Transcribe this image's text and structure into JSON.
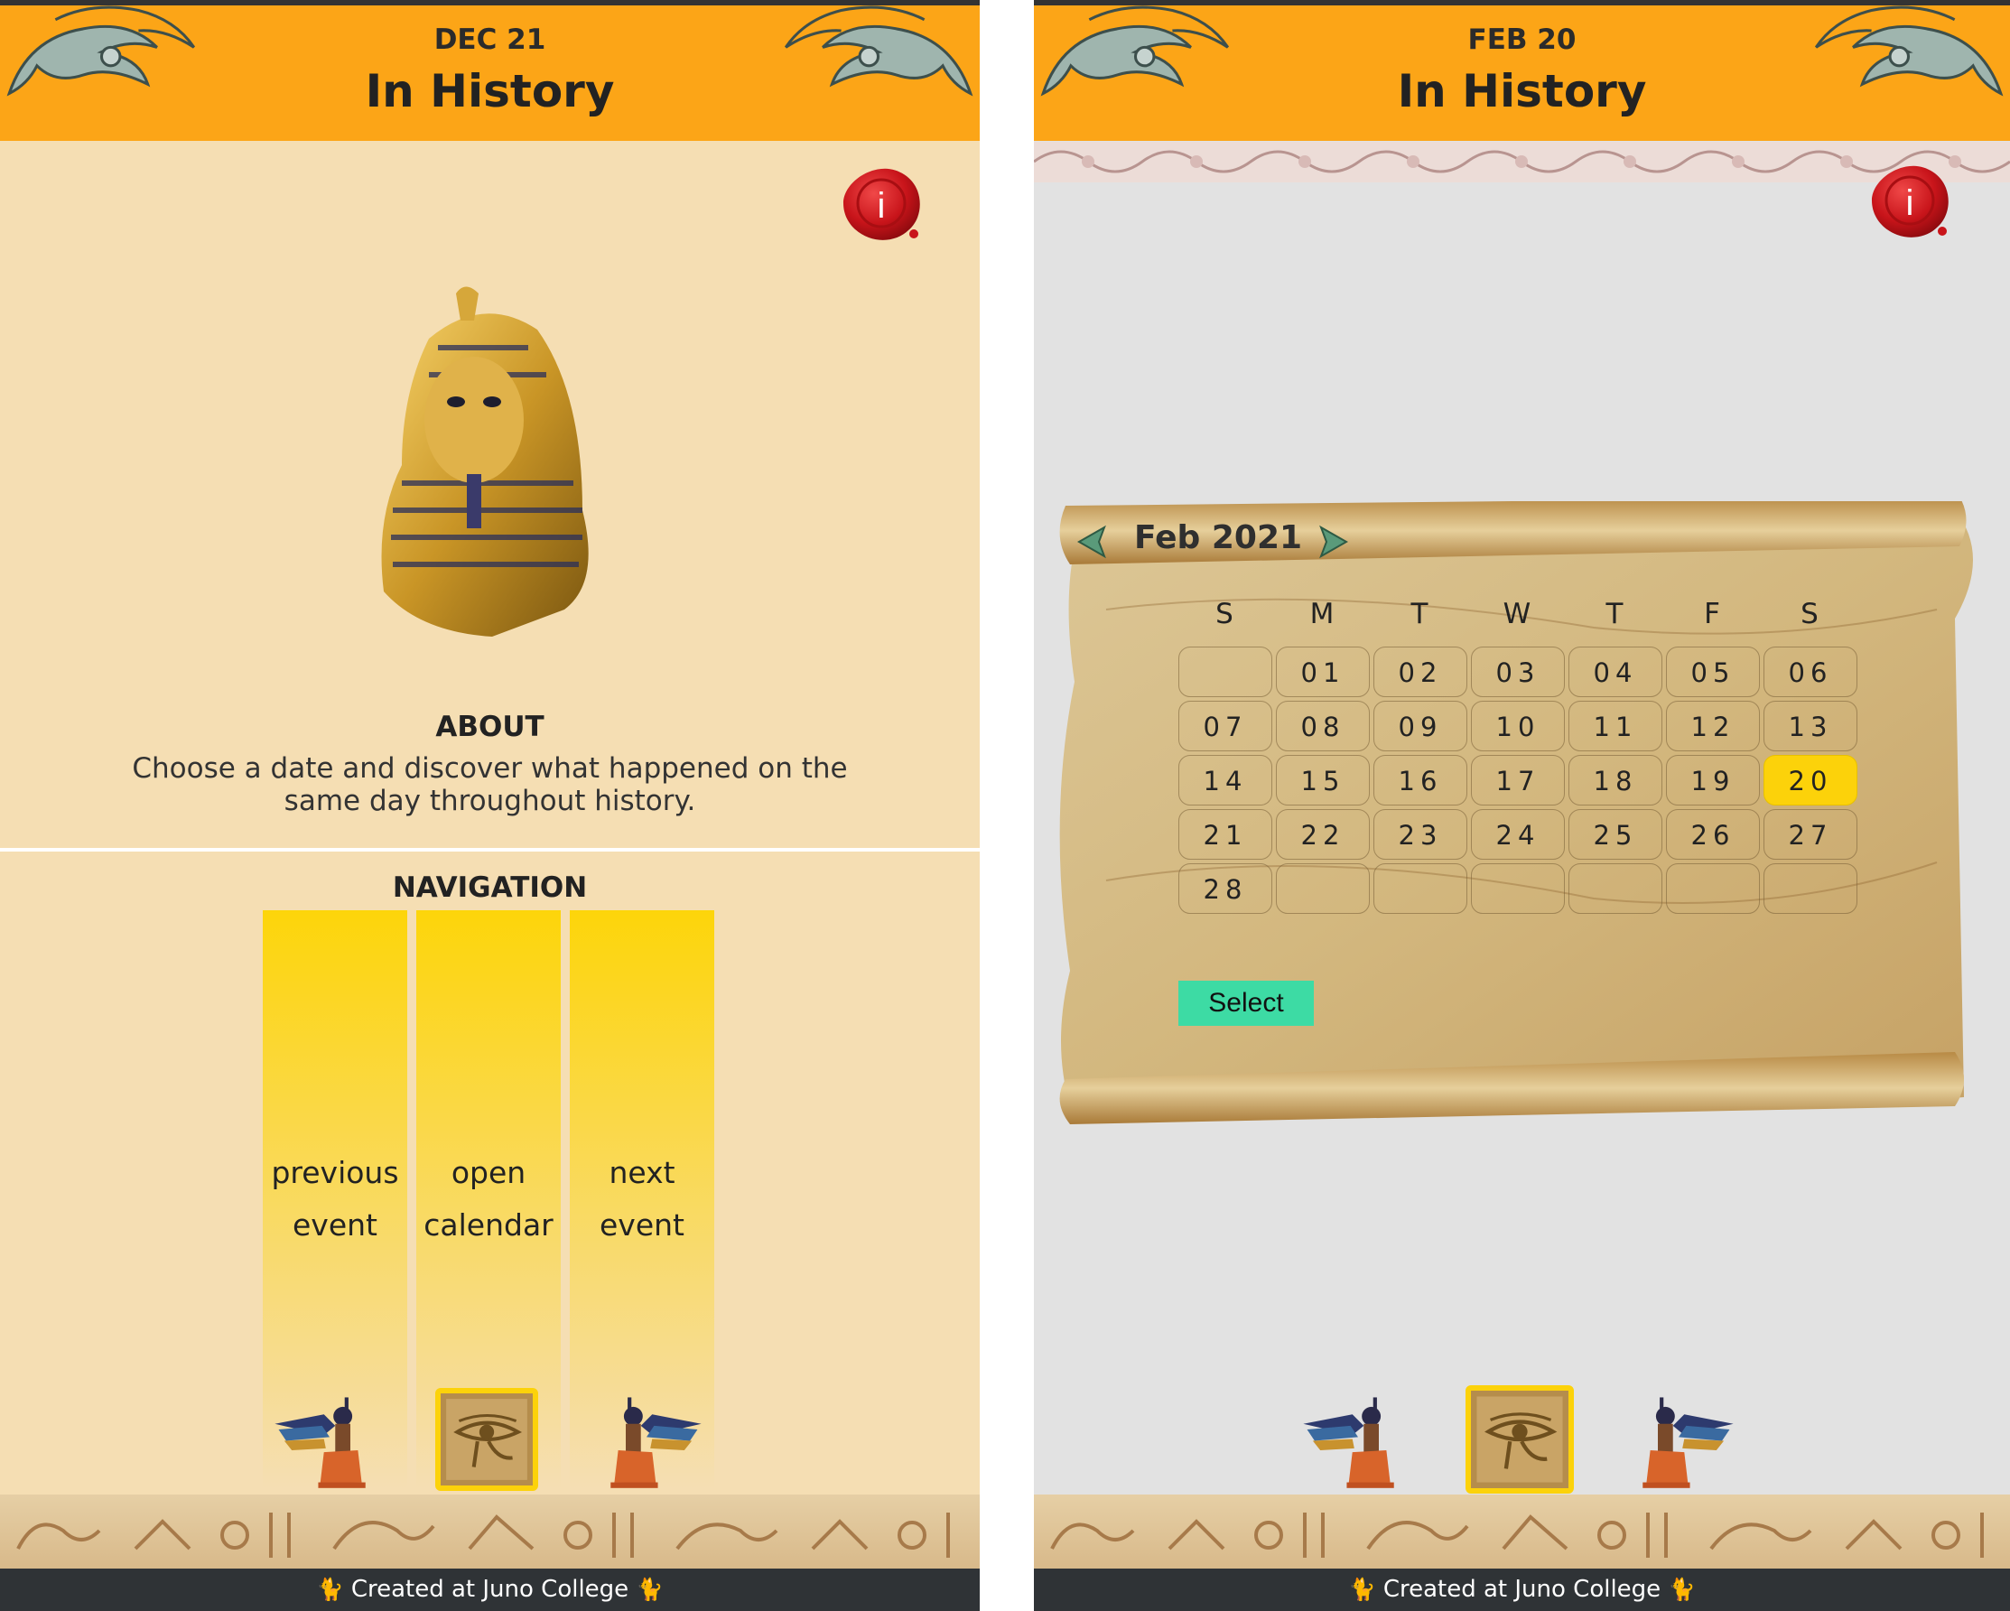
{
  "screens": [
    {
      "header": {
        "date": "DEC 21",
        "title": "In History"
      },
      "info_icon": "wax-seal-info-icon",
      "hero_image": "pharaoh-mask",
      "about": {
        "heading": "ABOUT",
        "text": "Choose a date and discover what happened on the same day throughout history."
      },
      "navigation": {
        "heading": "NAVIGATION",
        "buttons": [
          {
            "line1": "previous",
            "line2": "event",
            "icon": "winged-goddess-left-icon"
          },
          {
            "line1": "open",
            "line2": "calendar",
            "icon": "eye-of-horus-icon"
          },
          {
            "line1": "next",
            "line2": "event",
            "icon": "winged-goddess-right-icon"
          }
        ]
      },
      "footer": {
        "text": "Created at Juno College"
      }
    },
    {
      "header": {
        "date": "FEB 20",
        "title": "In History"
      },
      "info_icon": "wax-seal-info-icon",
      "calendar": {
        "month_label": "Feb 2021",
        "prev_icon": "green-scarab-left-icon",
        "next_icon": "green-scarab-right-icon",
        "weekdays": [
          "S",
          "M",
          "T",
          "W",
          "T",
          "F",
          "S"
        ],
        "weeks": [
          [
            "",
            "01",
            "02",
            "03",
            "04",
            "05",
            "06"
          ],
          [
            "07",
            "08",
            "09",
            "10",
            "11",
            "12",
            "13"
          ],
          [
            "14",
            "15",
            "16",
            "17",
            "18",
            "19",
            "20"
          ],
          [
            "21",
            "22",
            "23",
            "24",
            "25",
            "26",
            "27"
          ],
          [
            "28",
            "",
            "",
            "",
            "",
            "",
            ""
          ]
        ],
        "selected_day": "20",
        "select_label": "Select"
      },
      "nav_icons": [
        "winged-goddess-left-icon",
        "eye-of-horus-icon",
        "winged-goddess-right-icon"
      ],
      "footer": {
        "text": "Created at Juno College"
      }
    }
  ],
  "colors": {
    "header": "#fca517",
    "panel_left": "#f5deb3",
    "panel_right": "#e2e2e2",
    "accent_yellow": "#fcd20a",
    "select_button": "#3ddba4",
    "footer": "#2f3336"
  }
}
